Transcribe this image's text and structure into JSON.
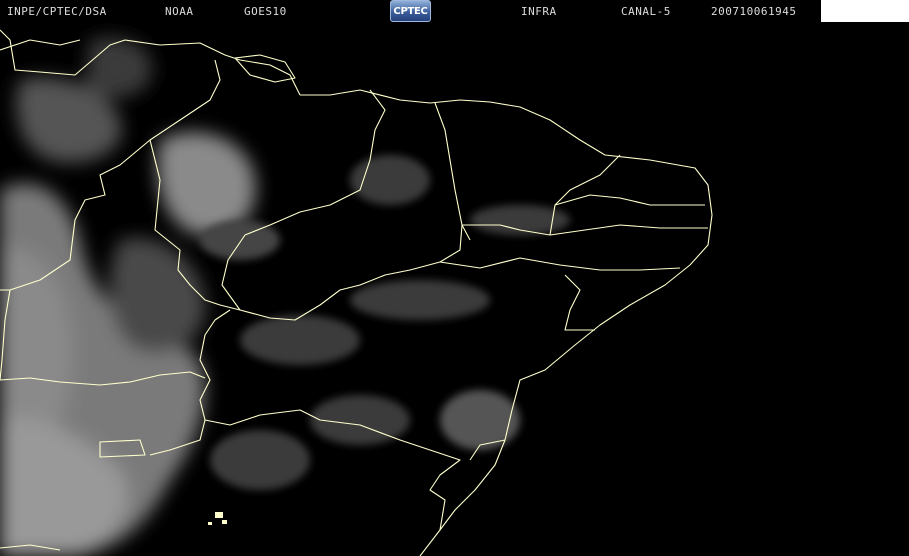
{
  "header": {
    "org": "INPE/CPTEC/DSA",
    "agency": "NOAA",
    "satellite": "GOES10",
    "product": "INFRA",
    "channel": "CANAL-5",
    "timestamp": "200710061945"
  },
  "logo": {
    "text": "CPTEC"
  },
  "colors": {
    "background": "#000000",
    "borders": "#ffffcc",
    "clouds": "#bfbfbf"
  }
}
